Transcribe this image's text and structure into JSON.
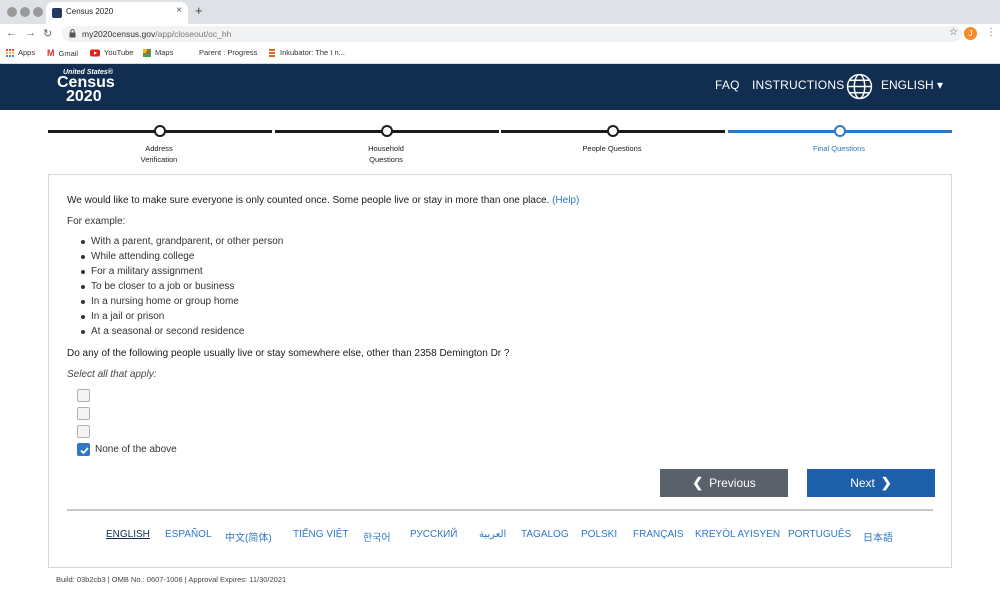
{
  "browser": {
    "tab_title": "Census 2020",
    "new_tab": "+",
    "tab_close": "×",
    "url_host": "my2020census.gov",
    "url_path": "/app/closeout/oc_hh",
    "profile_initial": "J",
    "bookmarks": [
      "Apps",
      "Gmail",
      "YouTube",
      "Maps",
      "Parent : Progress",
      "Inkubator: The I n..."
    ]
  },
  "header": {
    "logo_top": "United States®",
    "logo_line1": "Census",
    "logo_line2": "2020",
    "faq": "FAQ",
    "instructions": "INSTRUCTIONS",
    "language": "ENGLISH ▾",
    "brand_color": "#112e51"
  },
  "progress": {
    "steps": [
      {
        "label": "Address\nVerification",
        "state": "complete"
      },
      {
        "label": "Household\nQuestions",
        "state": "complete"
      },
      {
        "label": "People Questions",
        "state": "complete"
      },
      {
        "label": "Final Questions",
        "state": "current"
      }
    ],
    "active_color": "#2e78c6"
  },
  "form": {
    "intro": "We would like to make sure everyone is only counted once. Some people live or stay in more than one place.",
    "help_link": "(Help)",
    "example_heading": "For example:",
    "examples": [
      "With a parent, grandparent, or other person",
      "While attending college",
      "For a military assignment",
      "To be closer to a job or business",
      "In a nursing home or group home",
      "In a jail or prison",
      "At a seasonal or second residence"
    ],
    "question": "Do any of the following people usually live or stay somewhere else, other than 2358 Demington Dr ?",
    "hint": "Select all that apply:",
    "options": [
      {
        "label": "",
        "checked": false
      },
      {
        "label": "",
        "checked": false
      },
      {
        "label": "",
        "checked": false
      },
      {
        "label": "None of the above",
        "checked": true
      }
    ],
    "previous_label": "Previous",
    "next_label": "Next"
  },
  "languages": [
    "ENGLISH",
    "ESPAÑOL",
    "中文(简体)",
    "TIẾNG VIỆT",
    "한국어",
    "РУССКИЙ",
    "العربية",
    "TAGALOG",
    "POLSKI",
    "FRANÇAIS",
    "KREYÒL AYISYEN",
    "PORTUGUÊS",
    "日本語"
  ],
  "current_language": "ENGLISH",
  "footer": {
    "build": "Build: 03b2cb3",
    "omb": "OMB No.: 0607-1006",
    "approval": "Approval Expires: 11/30/2021",
    "separator": "|"
  }
}
